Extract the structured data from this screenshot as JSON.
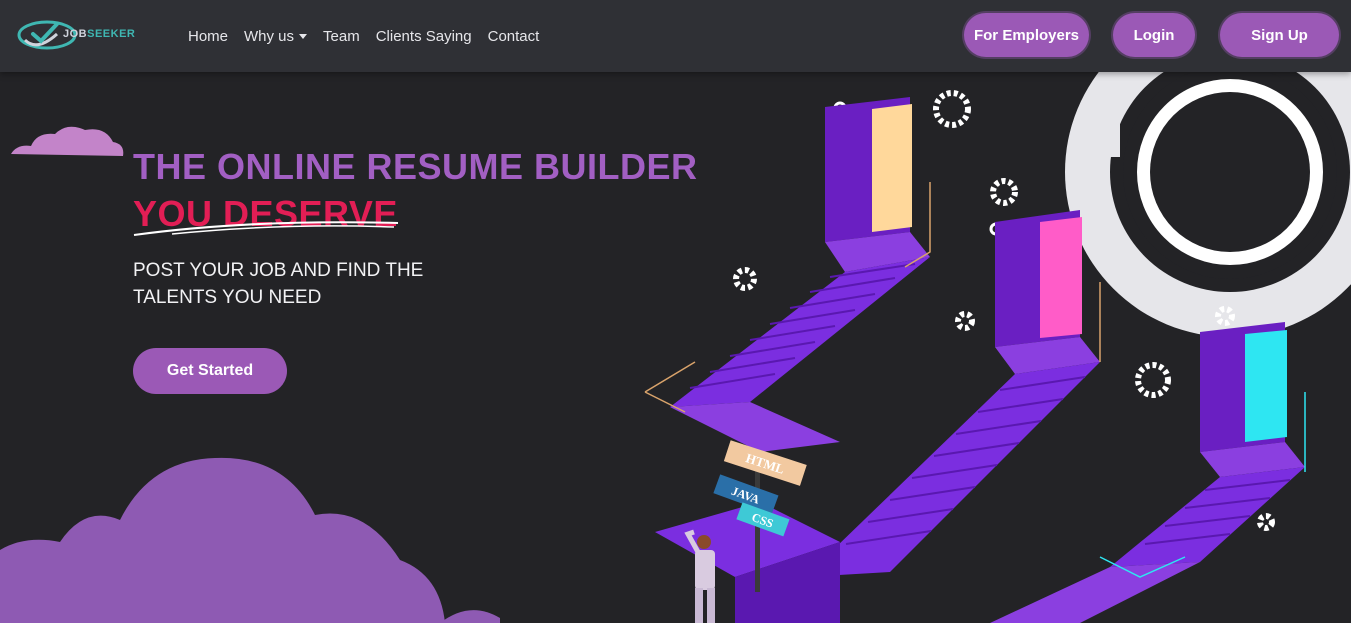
{
  "brand": {
    "logo_text_a": "JOB",
    "logo_text_b": "SEEKER"
  },
  "nav": {
    "items": [
      {
        "label": "Home"
      },
      {
        "label": "Why us"
      },
      {
        "label": "Team"
      },
      {
        "label": "Clients Saying"
      },
      {
        "label": "Contact"
      }
    ],
    "employers_label": "For Employers",
    "login_label": "Login",
    "signup_label": "Sign Up"
  },
  "hero": {
    "title_line1": "THE ONLINE RESUME BUILDER",
    "title_line2": "YOU DESERVE",
    "subtitle_line1": "POST YOUR JOB AND FIND THE",
    "subtitle_line2": "TALENTS YOU NEED",
    "cta_label": "Get Started"
  },
  "illustration": {
    "signs": [
      "HTML",
      "JAVA",
      "CSS"
    ],
    "door_colors": [
      "#ffd89b",
      "#ff5cc8",
      "#2ee6f2"
    ]
  },
  "colors": {
    "accent": "#9b59b6",
    "title_purple": "#a25fc3",
    "title_red": "#e21e55",
    "background": "#232326",
    "navbar": "#2f3035"
  }
}
